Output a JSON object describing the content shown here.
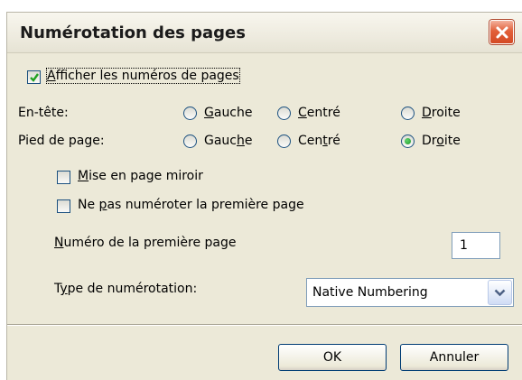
{
  "dialog": {
    "title": "Numérotation des pages",
    "close_icon": "close-x-icon",
    "show_page_numbers": {
      "label_pre": "",
      "label_u": "A",
      "label_post": "fficher les numéros de pages",
      "checked": true
    },
    "header_row": {
      "label": "En-tête:",
      "options": [
        {
          "u": "G",
          "rest": "auche",
          "pre": "",
          "checked": false
        },
        {
          "u": "C",
          "rest": "entré",
          "pre": "",
          "checked": false
        },
        {
          "u": "D",
          "rest": "roite",
          "pre": "",
          "checked": false
        }
      ]
    },
    "footer_row": {
      "label": "Pied de page:",
      "options": [
        {
          "pre": "Gauc",
          "u": "h",
          "rest": "e",
          "checked": false
        },
        {
          "pre": "Cen",
          "u": "t",
          "rest": "ré",
          "checked": false
        },
        {
          "pre": "Dr",
          "u": "o",
          "rest": "ite",
          "checked": true
        }
      ]
    },
    "mirror": {
      "pre": "",
      "u": "M",
      "rest": "ise en page miroir",
      "checked": false
    },
    "no_first": {
      "pre": "Ne ",
      "u": "p",
      "rest": "as numéroter la première page",
      "checked": false
    },
    "first_page_number": {
      "pre": "",
      "u": "N",
      "rest": "uméro de la première page",
      "value": "1"
    },
    "numbering_type": {
      "pre": "T",
      "u": "y",
      "rest": "pe de numérotation:",
      "value": "Native Numbering"
    },
    "ok_label": "OK",
    "cancel_label": "Annuler"
  }
}
